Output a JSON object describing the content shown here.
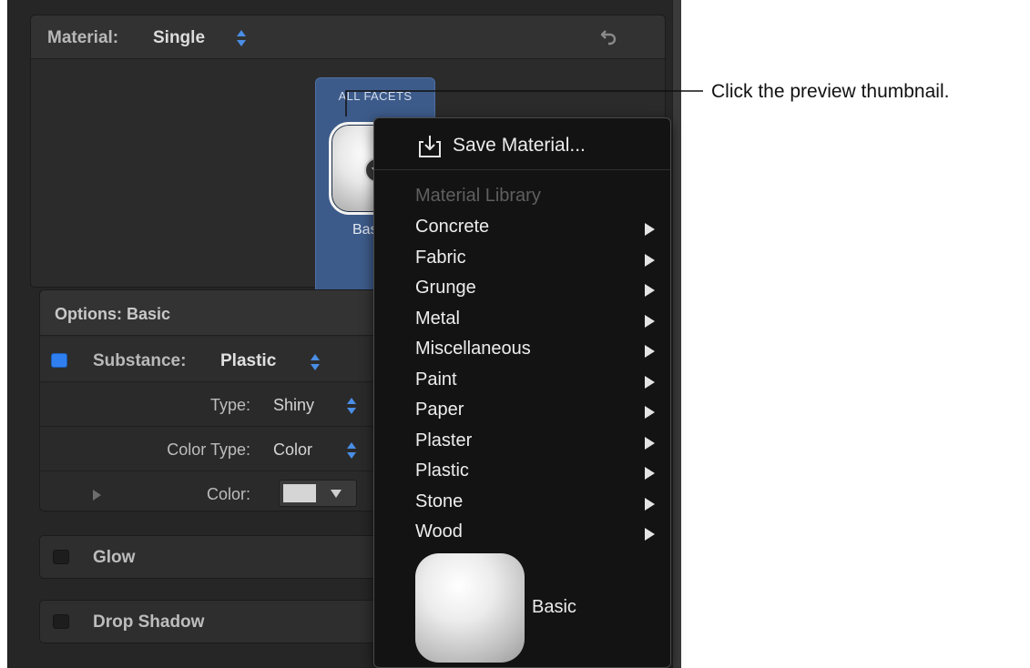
{
  "material": {
    "label": "Material:",
    "value": "Single",
    "thumbnail": {
      "title": "ALL FACETS",
      "name": "Basic"
    }
  },
  "options": {
    "title": "Options: Basic",
    "substance": {
      "label": "Substance:",
      "value": "Plastic",
      "enabled": true
    },
    "type": {
      "label": "Type:",
      "value": "Shiny"
    },
    "color_type": {
      "label": "Color Type:",
      "value": "Color"
    },
    "color": {
      "label": "Color:",
      "swatch": "#d5d5d5"
    }
  },
  "sections": {
    "glow": {
      "label": "Glow",
      "enabled": false
    },
    "drop_shadow": {
      "label": "Drop Shadow",
      "enabled": false
    }
  },
  "menu": {
    "save_label": "Save Material...",
    "library_header": "Material Library",
    "items": [
      {
        "label": "Concrete"
      },
      {
        "label": "Fabric"
      },
      {
        "label": "Grunge"
      },
      {
        "label": "Metal"
      },
      {
        "label": "Miscellaneous"
      },
      {
        "label": "Paint"
      },
      {
        "label": "Paper"
      },
      {
        "label": "Plaster"
      },
      {
        "label": "Plastic"
      },
      {
        "label": "Stone"
      },
      {
        "label": "Wood"
      }
    ],
    "preview_label": "Basic"
  },
  "callout": {
    "text": "Click the preview thumbnail."
  },
  "colors": {
    "accent": "#4a8ee6",
    "thumbnail_selected": "#3d5b8a",
    "panel_bg": "#262626",
    "menu_bg": "#131313"
  }
}
